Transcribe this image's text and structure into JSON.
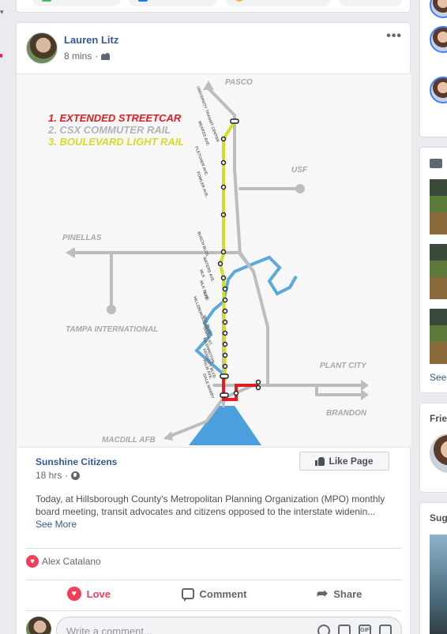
{
  "post": {
    "author": "Lauren Litz",
    "time": "8 mins",
    "meta_sep": "·",
    "map": {
      "legend": [
        {
          "label": "1. EXTENDED STREETCAR",
          "color": "#e21c21"
        },
        {
          "label": "2. CSX COMMUTER RAIL",
          "color": "#b3b3b3"
        },
        {
          "label": "3. BOULEVARD LIGHT RAIL",
          "color": "#d4dc2a"
        }
      ],
      "places": {
        "pasco": "PASCO",
        "usf": "USF",
        "pinellas": "PINELLAS",
        "tampa_intl": "TAMPA INTERNATIONAL",
        "plant_city": "PLANT CITY",
        "brandon": "BRANDON",
        "macdill": "MACDILL AFB"
      },
      "station_labels": [
        "UNIVERSITY TRANSIT CENTER",
        "BEARSS AVE.",
        "FLETCHER AVE.",
        "FOWLER AVE.",
        "BUSCH BLVD.",
        "WATERS AVE.",
        "MLK",
        "MLK BLVD.",
        "AVE.",
        "HILLSBOROUGH AVE.",
        "MLK BLVD.",
        "TAMPA ST.",
        "WASHINGTON",
        "KENNEDY BLVD.",
        "PALM AVE.",
        "DALE MABRY"
      ],
      "colors": {
        "streetcar": "#e21c21",
        "csx": "#bdbdbd",
        "light_rail": "#d4dc2a",
        "water": "#5aa9dc",
        "bay": "#4a9fdc"
      }
    },
    "shared": {
      "page_name": "Sunshine Citizens",
      "time": "18 hrs",
      "like_page": "Like Page",
      "description": "Today, at Hillsborough County's Metropolitan Planning Organization (MPO) monthly board meeting, transit advocates and citizens opposed to the interstate widenin...",
      "see_more": "See More"
    },
    "reaction_by": "Alex Catalano",
    "actions": {
      "love": "Love",
      "comment": "Comment",
      "share": "Share"
    },
    "comment_placeholder": "Write a comment...",
    "comment_icons": [
      "emoji-icon",
      "camera-icon",
      "gif-icon",
      "sticker-icon"
    ]
  },
  "right": {
    "friends_title": "Frie",
    "sug_title": "Sug",
    "see_label": "See"
  }
}
